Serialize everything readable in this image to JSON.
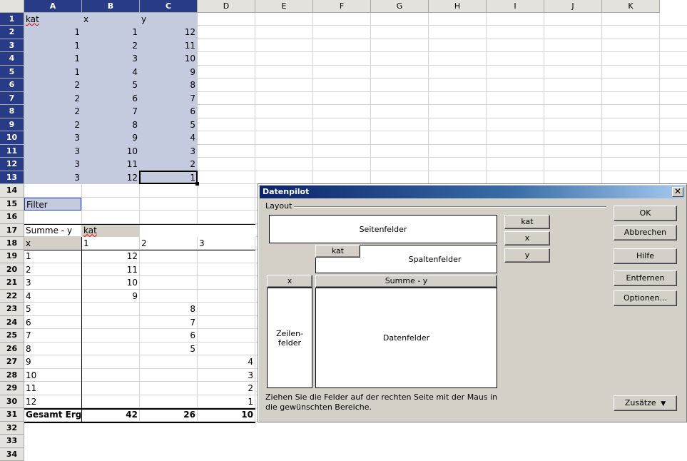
{
  "columns": [
    "A",
    "B",
    "C",
    "D",
    "E",
    "F",
    "G",
    "H",
    "I",
    "J",
    "K"
  ],
  "rows": [
    "1",
    "2",
    "3",
    "4",
    "5",
    "6",
    "7",
    "8",
    "9",
    "10",
    "11",
    "12",
    "13",
    "14",
    "15",
    "16",
    "17",
    "18",
    "19",
    "20",
    "21",
    "22",
    "23",
    "24",
    "25",
    "26",
    "27",
    "28",
    "29",
    "30",
    "31",
    "32",
    "33",
    "34"
  ],
  "source_table": {
    "headers": [
      "kat",
      "x",
      "y"
    ],
    "rows": [
      [
        "1",
        "1",
        "12"
      ],
      [
        "1",
        "2",
        "11"
      ],
      [
        "1",
        "3",
        "10"
      ],
      [
        "1",
        "4",
        "9"
      ],
      [
        "2",
        "5",
        "8"
      ],
      [
        "2",
        "6",
        "7"
      ],
      [
        "2",
        "7",
        "6"
      ],
      [
        "2",
        "8",
        "5"
      ],
      [
        "3",
        "9",
        "4"
      ],
      [
        "3",
        "10",
        "3"
      ],
      [
        "3",
        "11",
        "2"
      ],
      [
        "3",
        "12",
        "1"
      ]
    ]
  },
  "pivot": {
    "filter_label": "Filter",
    "data_field_label": "Summe - y",
    "col_field_label": "kat",
    "row_field_label": "x",
    "col_values": [
      "1",
      "2",
      "3"
    ],
    "row_values": [
      "1",
      "2",
      "3",
      "4",
      "5",
      "6",
      "7",
      "8",
      "9",
      "10",
      "11",
      "12"
    ],
    "cells": [
      [
        "12",
        "",
        ""
      ],
      [
        "11",
        "",
        ""
      ],
      [
        "10",
        "",
        ""
      ],
      [
        "9",
        "",
        ""
      ],
      [
        "",
        "8",
        ""
      ],
      [
        "",
        "7",
        ""
      ],
      [
        "",
        "6",
        ""
      ],
      [
        "",
        "5",
        ""
      ],
      [
        "",
        "",
        "4"
      ],
      [
        "",
        "",
        "3"
      ],
      [
        "",
        "",
        "2"
      ],
      [
        "",
        "",
        "1"
      ]
    ],
    "total_label": "Gesamt Erg",
    "totals": [
      "42",
      "26",
      "10"
    ]
  },
  "dialog": {
    "title": "Datenpilot",
    "close_glyph": "✕",
    "layout_label": "Layout",
    "page_area_label": "Seitenfelder",
    "column_area_label": "Spaltenfelder",
    "row_area_label": "Zeilen-felder",
    "data_area_label": "Datenfelder",
    "column_field_chip": "kat",
    "row_field_chip": "x",
    "data_field_chip": "Summe - y",
    "available_fields": [
      "kat",
      "x",
      "y"
    ],
    "buttons": {
      "ok": "OK",
      "cancel": "Abbrechen",
      "help": "Hilfe",
      "remove": "Entfernen",
      "options": "Optionen...",
      "more": "Zusätze"
    },
    "more_icon": "double-chevron-down-icon",
    "hint": "Ziehen Sie die Felder auf der rechten Seite mit der Maus in die gewünschten Bereiche."
  }
}
